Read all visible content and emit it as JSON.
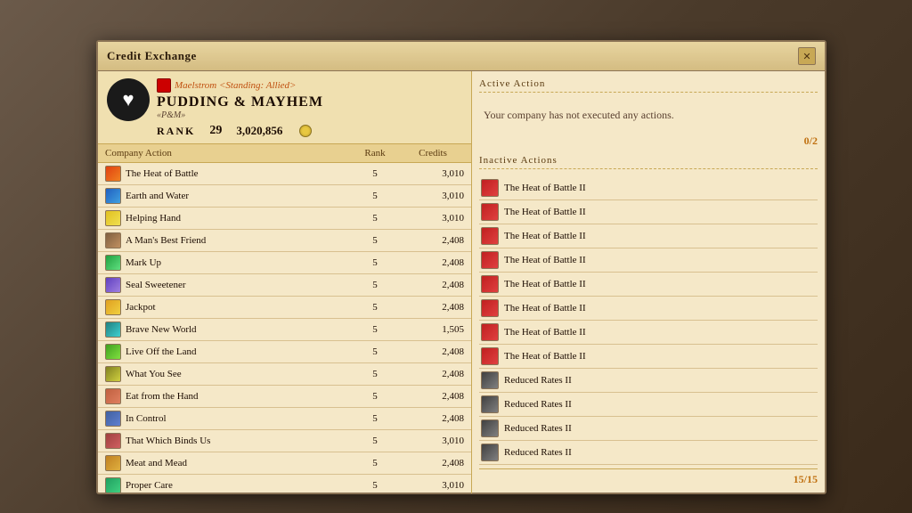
{
  "window": {
    "title": "Credit Exchange",
    "close_label": "✕"
  },
  "company": {
    "gc_name": "Maelstrom <Standing: Allied>",
    "name": "Pudding & Mayhem",
    "tag": "«P&M»",
    "rank_label": "Rank",
    "rank_value": "29",
    "credits": "3,020,856"
  },
  "table": {
    "headers": [
      "Company Action",
      "Rank",
      "Credits"
    ],
    "rows": [
      {
        "name": "The Heat of Battle",
        "rank": "5",
        "credits": "3,010",
        "icon": "fire"
      },
      {
        "name": "Earth and Water",
        "rank": "5",
        "credits": "3,010",
        "icon": "water"
      },
      {
        "name": "Helping Hand",
        "rank": "5",
        "credits": "3,010",
        "icon": "hand"
      },
      {
        "name": "A Man's Best Friend",
        "rank": "5",
        "credits": "2,408",
        "icon": "dog"
      },
      {
        "name": "Mark Up",
        "rank": "5",
        "credits": "2,408",
        "icon": "up"
      },
      {
        "name": "Seal Sweetener",
        "rank": "5",
        "credits": "2,408",
        "icon": "seal"
      },
      {
        "name": "Jackpot",
        "rank": "5",
        "credits": "2,408",
        "icon": "gold"
      },
      {
        "name": "Brave New World",
        "rank": "5",
        "credits": "1,505",
        "icon": "world"
      },
      {
        "name": "Live Off the Land",
        "rank": "5",
        "credits": "2,408",
        "icon": "leaf"
      },
      {
        "name": "What You See",
        "rank": "5",
        "credits": "2,408",
        "icon": "eye"
      },
      {
        "name": "Eat from the Hand",
        "rank": "5",
        "credits": "2,408",
        "icon": "eat"
      },
      {
        "name": "In Control",
        "rank": "5",
        "credits": "2,408",
        "icon": "ctrl"
      },
      {
        "name": "That Which Binds Us",
        "rank": "5",
        "credits": "3,010",
        "icon": "bind"
      },
      {
        "name": "Meat and Mead",
        "rank": "5",
        "credits": "2,408",
        "icon": "mead"
      },
      {
        "name": "Proper Care",
        "rank": "5",
        "credits": "3,010",
        "icon": "care"
      }
    ]
  },
  "active_section": {
    "title": "Active Action",
    "empty_text": "Your company has not executed any actions.",
    "count": "0/2"
  },
  "inactive_section": {
    "title": "Inactive Actions",
    "items": [
      {
        "name": "The Heat of Battle II",
        "icon": "battle"
      },
      {
        "name": "The Heat of Battle II",
        "icon": "battle"
      },
      {
        "name": "The Heat of Battle II",
        "icon": "battle"
      },
      {
        "name": "The Heat of Battle II",
        "icon": "battle"
      },
      {
        "name": "The Heat of Battle II",
        "icon": "battle"
      },
      {
        "name": "The Heat of Battle II",
        "icon": "battle"
      },
      {
        "name": "The Heat of Battle II",
        "icon": "battle"
      },
      {
        "name": "The Heat of Battle II",
        "icon": "battle"
      },
      {
        "name": "Reduced Rates II",
        "icon": "rate"
      },
      {
        "name": "Reduced Rates II",
        "icon": "rate"
      },
      {
        "name": "Reduced Rates II",
        "icon": "rate"
      },
      {
        "name": "Reduced Rates II",
        "icon": "rate"
      }
    ],
    "total": "15/15"
  }
}
